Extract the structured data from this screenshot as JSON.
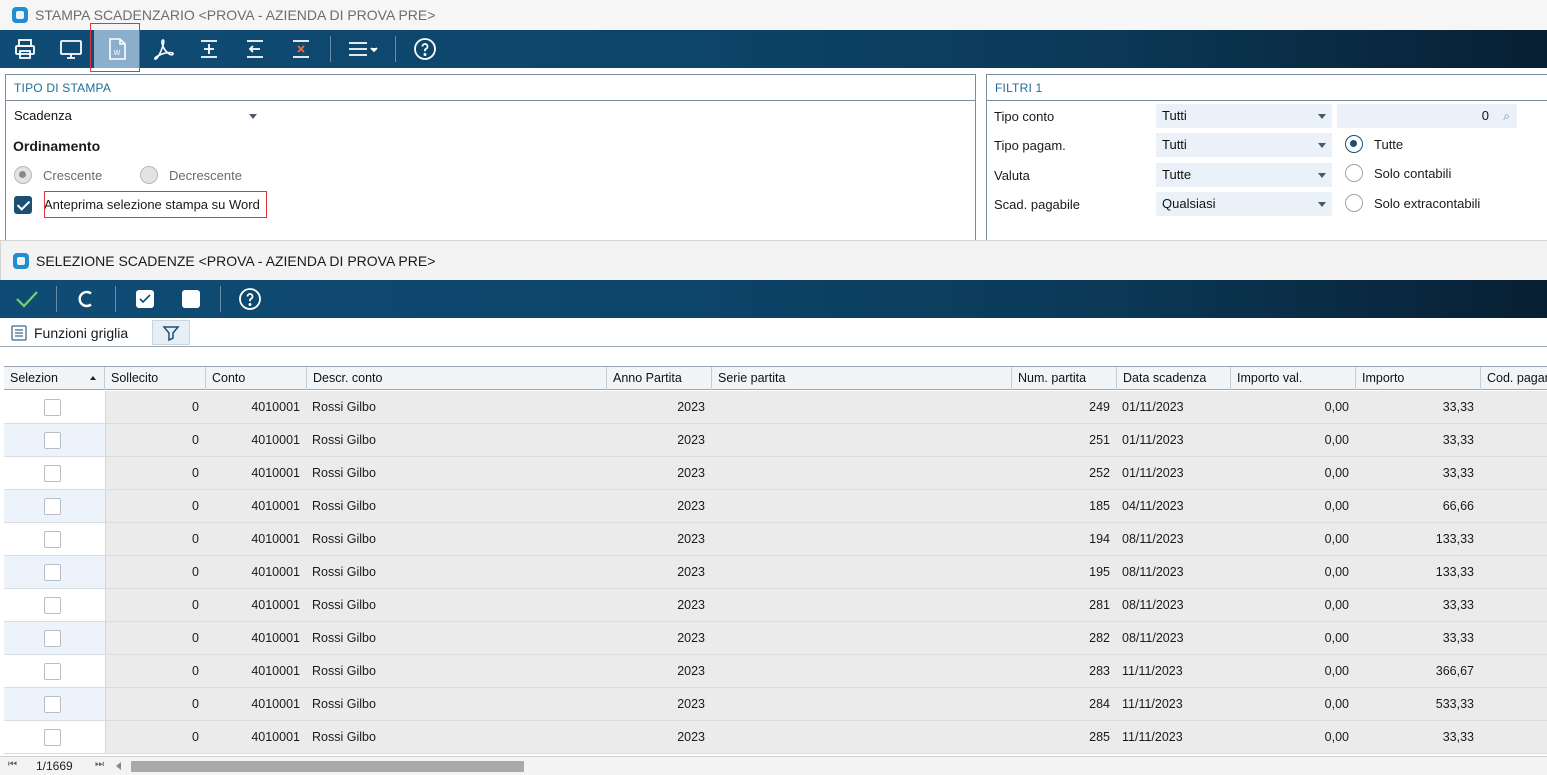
{
  "main_window": {
    "title": "STAMPA SCADENZARIO <PROVA - AZIENDA DI PROVA PRE>",
    "toolbar_icons": [
      "print-icon",
      "monitor-icon",
      "word-icon",
      "pdf-icon",
      "add-icon",
      "back-icon",
      "close-icon",
      "menu-icon",
      "help-icon"
    ]
  },
  "tipo_stampa": {
    "header": "TIPO DI STAMPA",
    "tipo_value": "Scadenza",
    "ordinamento_label": "Ordinamento",
    "crescente": "Crescente",
    "decrescente": "Decrescente",
    "anteprima_label": "Anteprima selezione stampa su Word"
  },
  "filtri": {
    "header": "FILTRI 1",
    "tipo_conto_label": "Tipo conto",
    "tipo_conto_value": "Tutti",
    "tipo_conto_code": "0",
    "tipo_pagam_label": "Tipo pagam.",
    "tipo_pagam_value": "Tutti",
    "valuta_label": "Valuta",
    "valuta_value": "Tutte",
    "scad_pagabile_label": "Scad. pagabile",
    "scad_pagabile_value": "Qualsiasi",
    "radio_tutte": "Tutte",
    "radio_solo_contabili": "Solo contabili",
    "radio_solo_extracontabili": "Solo extracontabili"
  },
  "selezione_window": {
    "title": "SELEZIONE SCADENZE <PROVA - AZIENDA DI PROVA PRE>",
    "funzioni_griglia": "Funzioni griglia"
  },
  "grid": {
    "columns": [
      "Selezion",
      "Sollecito",
      "Conto",
      "Descr. conto",
      "Anno Partita",
      "Serie partita",
      "Num. partita",
      "Data scadenza",
      "Importo val.",
      "Importo",
      "Cod. pagam"
    ],
    "rows": [
      {
        "sollecito": "0",
        "conto": "4010001",
        "descr": "Rossi Gilbo",
        "anno": "2023",
        "serie": "",
        "num": "249",
        "data": "01/11/2023",
        "importo_val": "0,00",
        "importo": "33,33"
      },
      {
        "sollecito": "0",
        "conto": "4010001",
        "descr": "Rossi Gilbo",
        "anno": "2023",
        "serie": "",
        "num": "251",
        "data": "01/11/2023",
        "importo_val": "0,00",
        "importo": "33,33"
      },
      {
        "sollecito": "0",
        "conto": "4010001",
        "descr": "Rossi Gilbo",
        "anno": "2023",
        "serie": "",
        "num": "252",
        "data": "01/11/2023",
        "importo_val": "0,00",
        "importo": "33,33"
      },
      {
        "sollecito": "0",
        "conto": "4010001",
        "descr": "Rossi Gilbo",
        "anno": "2023",
        "serie": "",
        "num": "185",
        "data": "04/11/2023",
        "importo_val": "0,00",
        "importo": "66,66"
      },
      {
        "sollecito": "0",
        "conto": "4010001",
        "descr": "Rossi Gilbo",
        "anno": "2023",
        "serie": "",
        "num": "194",
        "data": "08/11/2023",
        "importo_val": "0,00",
        "importo": "133,33"
      },
      {
        "sollecito": "0",
        "conto": "4010001",
        "descr": "Rossi Gilbo",
        "anno": "2023",
        "serie": "",
        "num": "195",
        "data": "08/11/2023",
        "importo_val": "0,00",
        "importo": "133,33"
      },
      {
        "sollecito": "0",
        "conto": "4010001",
        "descr": "Rossi Gilbo",
        "anno": "2023",
        "serie": "",
        "num": "281",
        "data": "08/11/2023",
        "importo_val": "0,00",
        "importo": "33,33"
      },
      {
        "sollecito": "0",
        "conto": "4010001",
        "descr": "Rossi Gilbo",
        "anno": "2023",
        "serie": "",
        "num": "282",
        "data": "08/11/2023",
        "importo_val": "0,00",
        "importo": "33,33"
      },
      {
        "sollecito": "0",
        "conto": "4010001",
        "descr": "Rossi Gilbo",
        "anno": "2023",
        "serie": "",
        "num": "283",
        "data": "11/11/2023",
        "importo_val": "0,00",
        "importo": "366,67"
      },
      {
        "sollecito": "0",
        "conto": "4010001",
        "descr": "Rossi Gilbo",
        "anno": "2023",
        "serie": "",
        "num": "284",
        "data": "11/11/2023",
        "importo_val": "0,00",
        "importo": "533,33"
      },
      {
        "sollecito": "0",
        "conto": "4010001",
        "descr": "Rossi Gilbo",
        "anno": "2023",
        "serie": "",
        "num": "285",
        "data": "11/11/2023",
        "importo_val": "0,00",
        "importo": "33,33"
      }
    ]
  },
  "footer": {
    "record_position": "1/1669"
  },
  "colors": {
    "toolbar": "#0f4c75",
    "accent_blue": "#1e6d9c",
    "highlight_red": "#e0353b",
    "checkbox_blue": "#1d4f72"
  }
}
